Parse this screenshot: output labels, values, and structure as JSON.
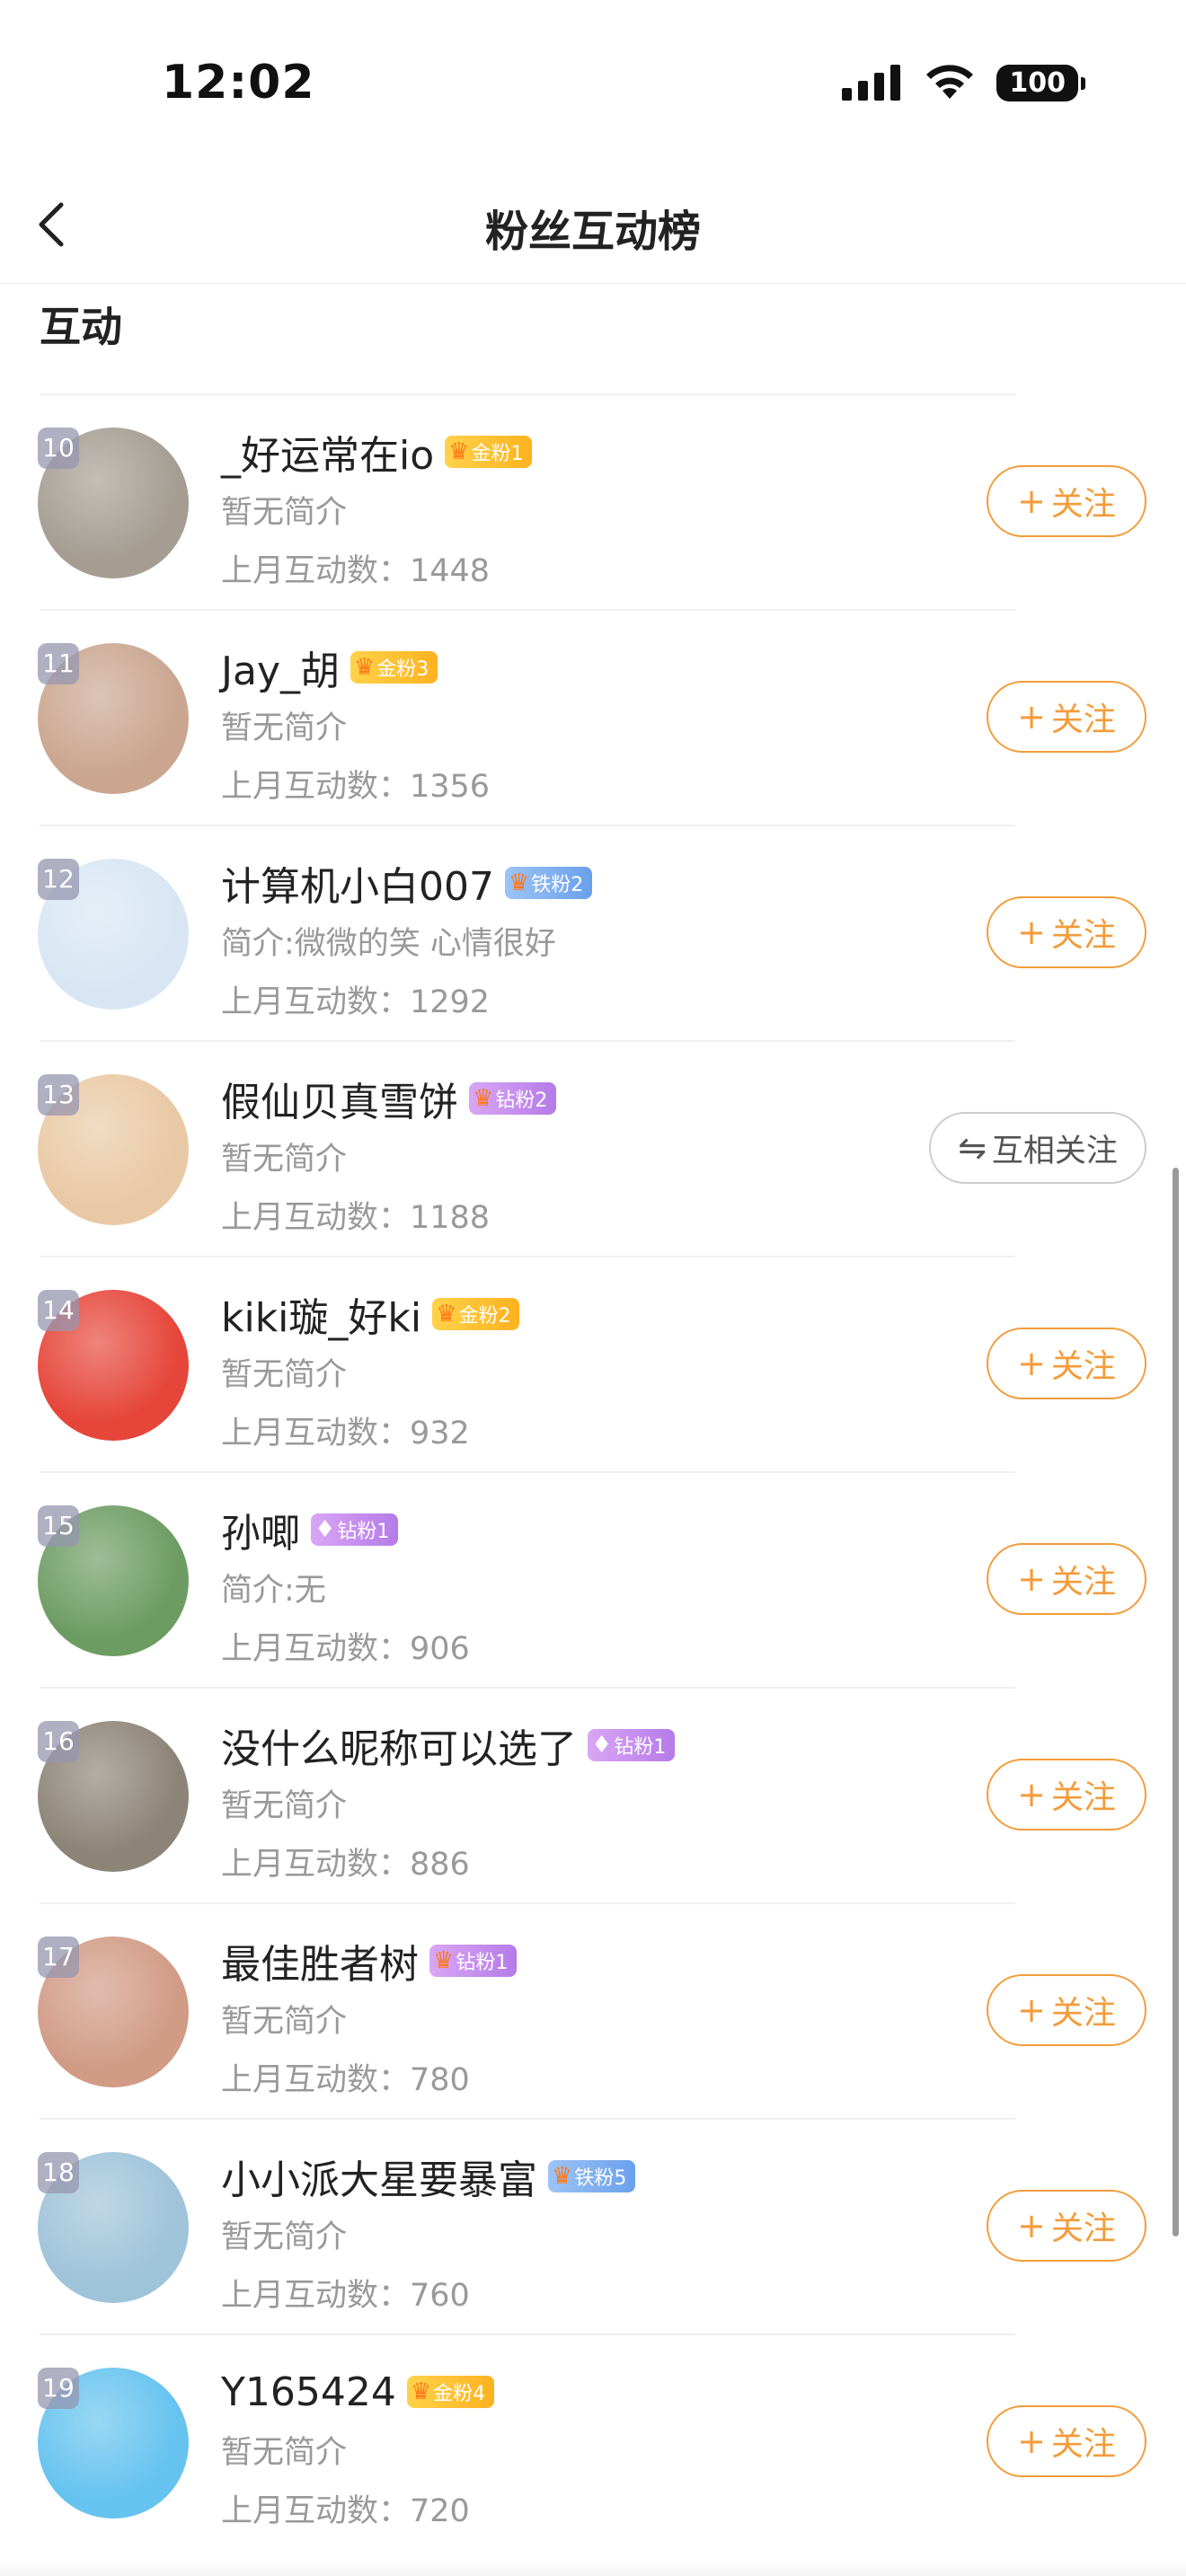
{
  "status": {
    "time": "12:02",
    "battery": "100"
  },
  "nav": {
    "title": "粉丝互动榜"
  },
  "section": {
    "title": "互动"
  },
  "list": [
    {
      "rank": "10",
      "name": "_好运常在io",
      "badge": "金粉1",
      "badge_type": "gold",
      "bio": "暂无简介",
      "count": "上月互动数：1448",
      "button": "关注",
      "button_type": "follow",
      "avatar_color": "#a59d92"
    },
    {
      "rank": "11",
      "name": "Jay_胡",
      "badge": "金粉3",
      "badge_type": "gold",
      "bio": "暂无简介",
      "count": "上月互动数：1356",
      "button": "关注",
      "button_type": "follow",
      "avatar_color": "#caa690"
    },
    {
      "rank": "12",
      "name": "计算机小白007",
      "badge": "铁粉2",
      "badge_type": "iron",
      "bio": "简介:微微的笑 心情很好",
      "count": "上月互动数：1292",
      "button": "关注",
      "button_type": "follow",
      "avatar_color": "#d8e6f3"
    },
    {
      "rank": "13",
      "name": "假仙贝真雪饼",
      "badge": "钻粉2",
      "badge_type": "diamond-crown",
      "bio": "暂无简介",
      "count": "上月互动数：1188",
      "button": "互相关注",
      "button_type": "mutual",
      "avatar_color": "#e9c9a5"
    },
    {
      "rank": "14",
      "name": "kiki璇_好ki",
      "badge": "金粉2",
      "badge_type": "gold",
      "bio": "暂无简介",
      "count": "上月互动数：932",
      "button": "关注",
      "button_type": "follow",
      "avatar_color": "#e6463a"
    },
    {
      "rank": "15",
      "name": "孙唧",
      "badge": "钻粉1",
      "badge_type": "diamond",
      "bio": "简介:无",
      "count": "上月互动数：906",
      "button": "关注",
      "button_type": "follow",
      "avatar_color": "#6d9c63"
    },
    {
      "rank": "16",
      "name": "没什么昵称可以选了",
      "badge": "钻粉1",
      "badge_type": "diamond",
      "bio": "暂无简介",
      "count": "上月互动数：886",
      "button": "关注",
      "button_type": "follow",
      "avatar_color": "#8d8478"
    },
    {
      "rank": "17",
      "name": "最佳胜者树",
      "badge": "钻粉1",
      "badge_type": "diamond-crown",
      "bio": "暂无简介",
      "count": "上月互动数：780",
      "button": "关注",
      "button_type": "follow",
      "avatar_color": "#d19b86"
    },
    {
      "rank": "18",
      "name": "小小派大星要暴富",
      "badge": "铁粉5",
      "badge_type": "iron",
      "bio": "暂无简介",
      "count": "上月互动数：760",
      "button": "关注",
      "button_type": "follow",
      "avatar_color": "#9fc3d9"
    },
    {
      "rank": "19",
      "name": "Y165424",
      "badge": "金粉4",
      "badge_type": "gold",
      "bio": "暂无简介",
      "count": "上月互动数：720",
      "button": "关注",
      "button_type": "follow",
      "avatar_color": "#66c3ef"
    }
  ]
}
